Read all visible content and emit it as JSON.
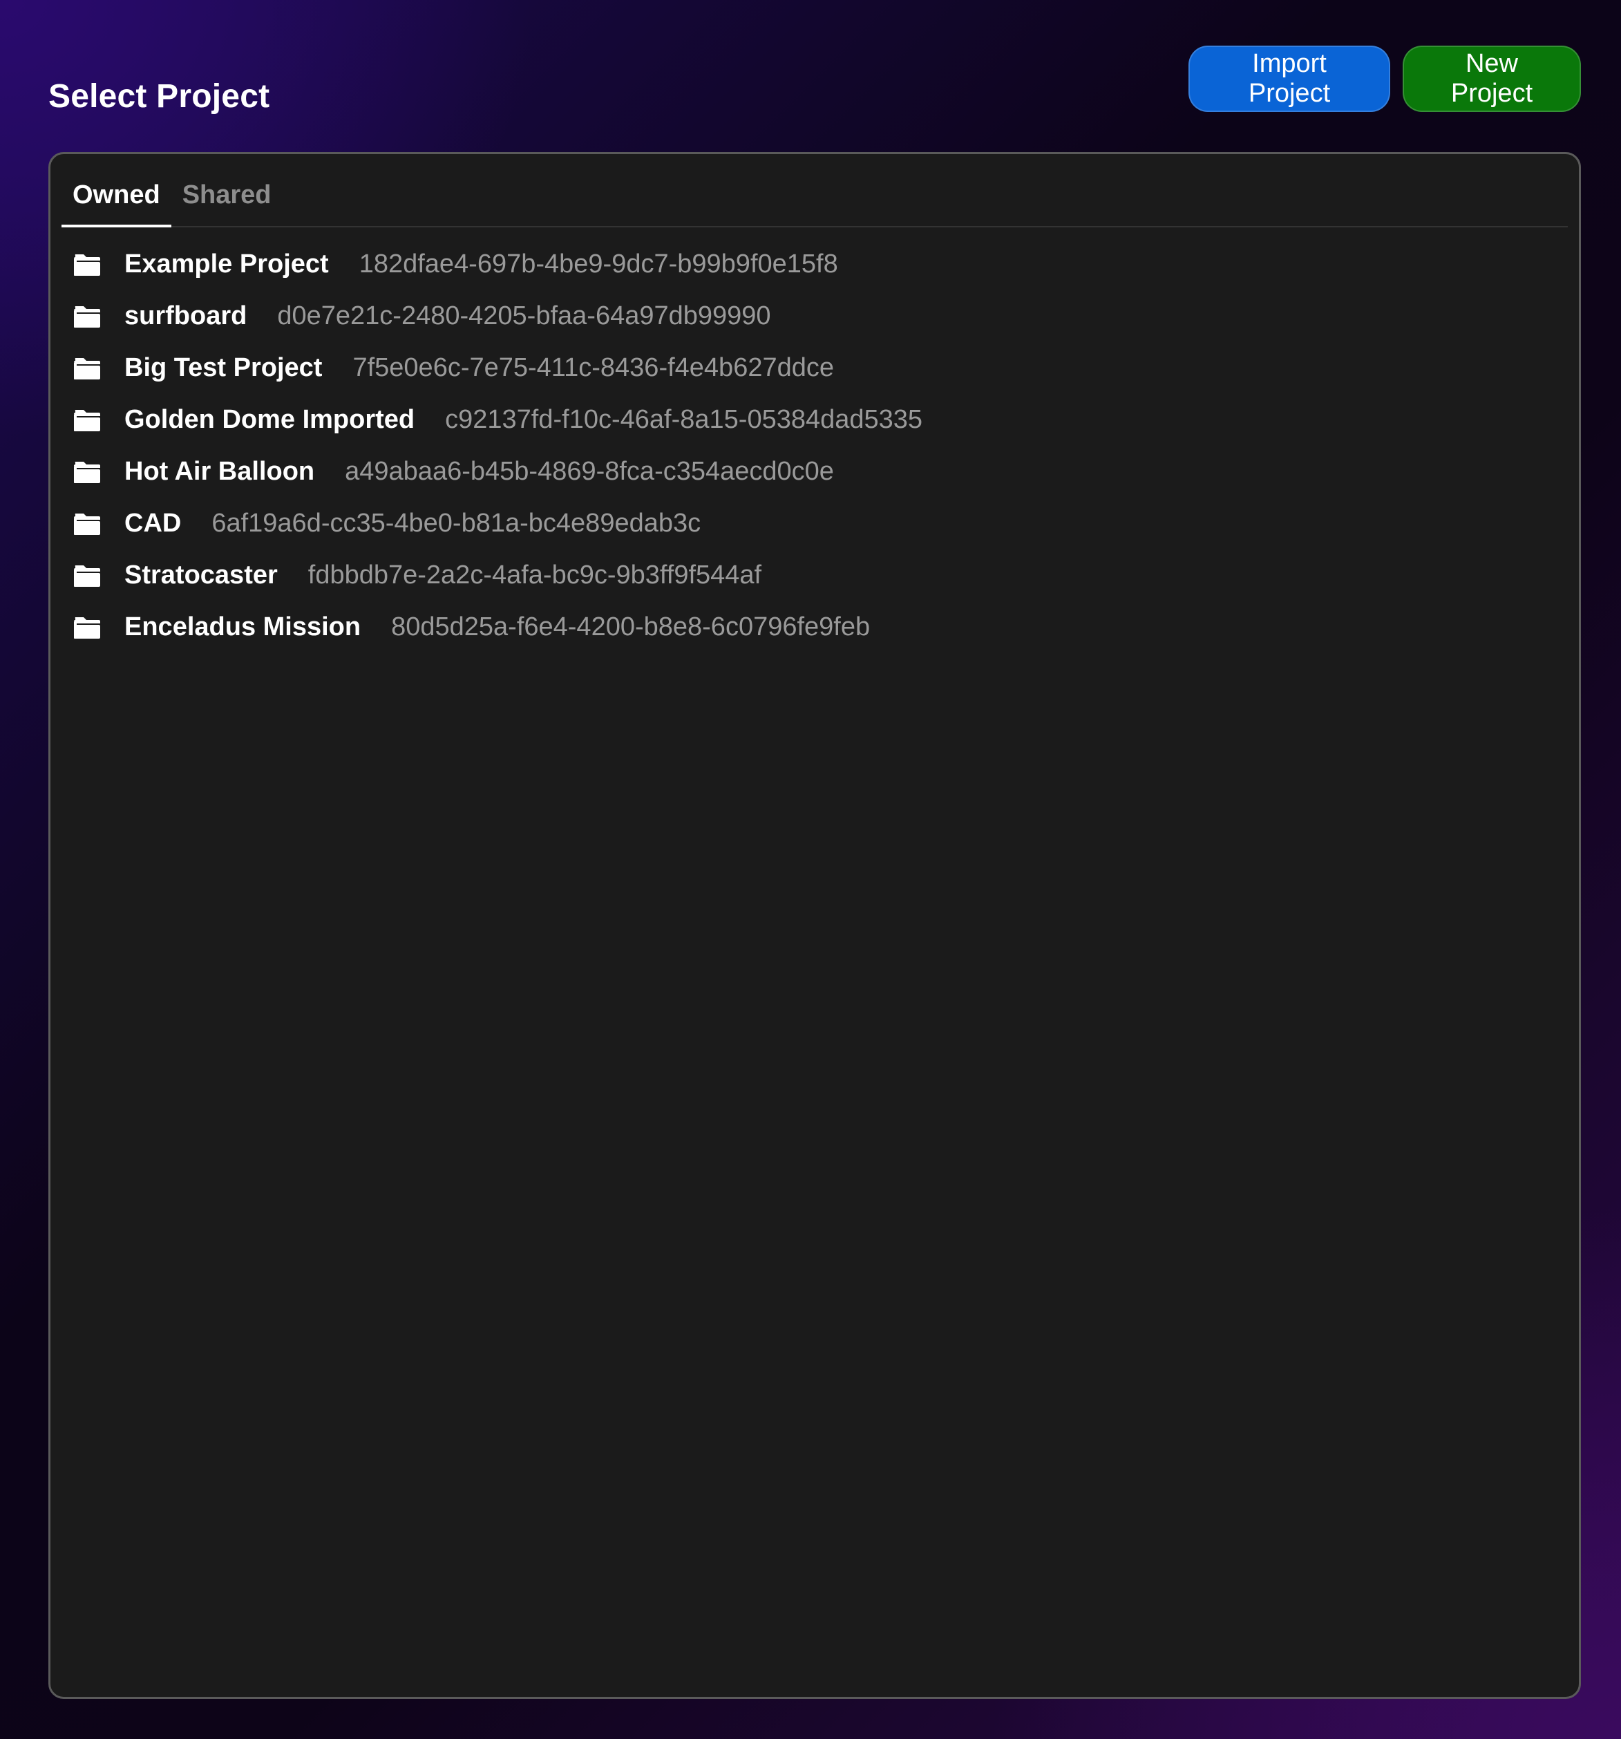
{
  "header": {
    "title": "Select Project",
    "import_label": "Import Project",
    "new_label": "New Project"
  },
  "colors": {
    "import_button": "#0a64d6",
    "new_button": "#0a780a",
    "panel_background": "#1b1b1b",
    "id_text": "#9a9a9a"
  },
  "tabs": [
    {
      "label": "Owned",
      "active": true
    },
    {
      "label": "Shared",
      "active": false
    }
  ],
  "project_icon": "folder-icon",
  "projects": [
    {
      "name": "Example Project",
      "id": "182dfae4-697b-4be9-9dc7-b99b9f0e15f8"
    },
    {
      "name": "surfboard",
      "id": "d0e7e21c-2480-4205-bfaa-64a97db99990"
    },
    {
      "name": "Big Test Project",
      "id": "7f5e0e6c-7e75-411c-8436-f4e4b627ddce"
    },
    {
      "name": "Golden Dome Imported",
      "id": "c92137fd-f10c-46af-8a15-05384dad5335"
    },
    {
      "name": "Hot Air Balloon",
      "id": "a49abaa6-b45b-4869-8fca-c354aecd0c0e"
    },
    {
      "name": "CAD",
      "id": "6af19a6d-cc35-4be0-b81a-bc4e89edab3c"
    },
    {
      "name": "Stratocaster",
      "id": "fdbbdb7e-2a2c-4afa-bc9c-9b3ff9f544af"
    },
    {
      "name": "Enceladus Mission",
      "id": "80d5d25a-f6e4-4200-b8e8-6c0796fe9feb"
    }
  ]
}
